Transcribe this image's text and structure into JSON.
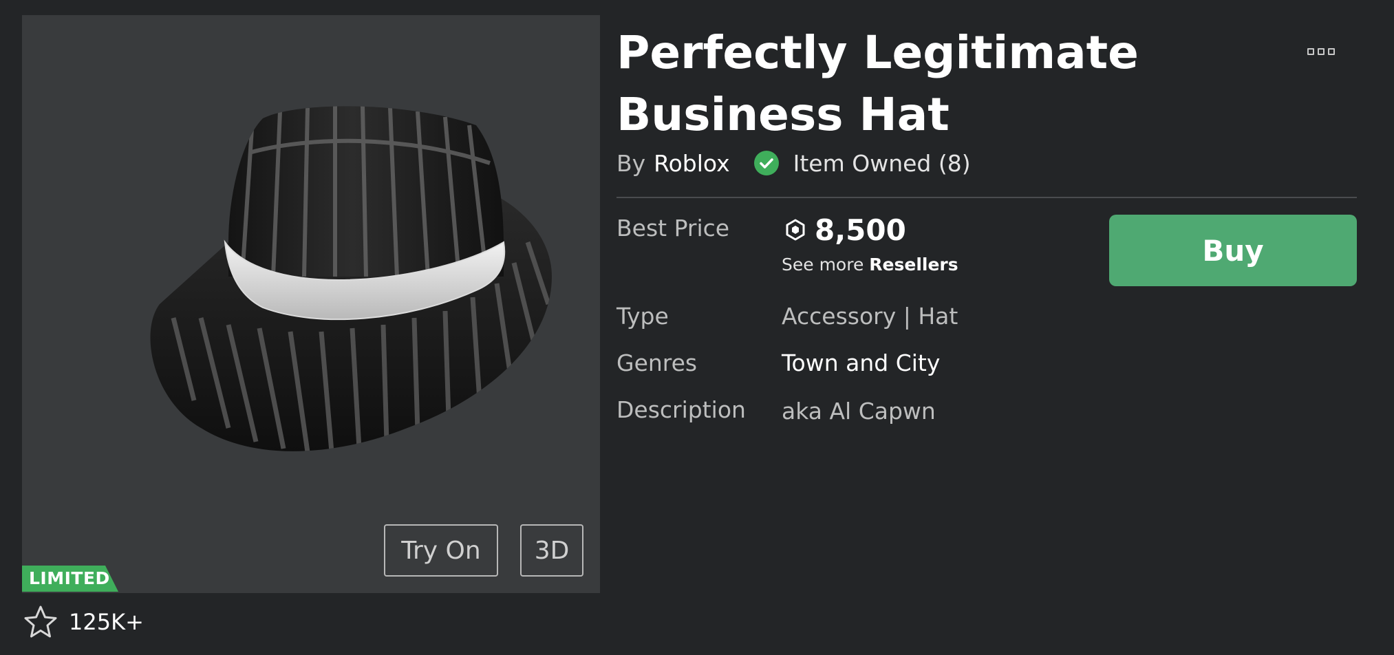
{
  "item": {
    "title_line1": "Perfectly Legitimate",
    "title_line2": "Business Hat",
    "by_label": "By",
    "creator": "Roblox",
    "owned_text": "Item Owned (8)",
    "badge": "LIMITED"
  },
  "thumbnail": {
    "try_on_label": "Try On",
    "three_d_label": "3D"
  },
  "favorites": {
    "count": "125K+",
    "icon": "star-icon"
  },
  "details": {
    "best_price_label": "Best Price",
    "best_price": "8,500",
    "see_more_prefix": "See more",
    "resellers_link": "Resellers",
    "type_label": "Type",
    "type_value": "Accessory | Hat",
    "genres_label": "Genres",
    "genres_value": "Town and City",
    "description_label": "Description",
    "description_value": "aka Al Capwn"
  },
  "actions": {
    "buy_label": "Buy",
    "more_icon": "more-options-icon"
  },
  "colors": {
    "background": "#232527",
    "panel": "#393b3d",
    "buy_green": "#4fa972",
    "limited_green": "#3fae5b",
    "owned_check_green": "#3fae5b"
  }
}
